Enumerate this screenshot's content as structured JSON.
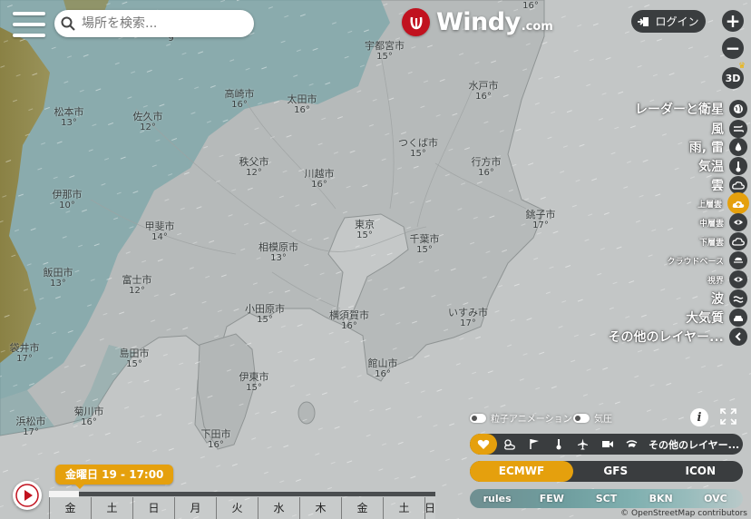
{
  "header": {
    "search_placeholder": "場所を検索...",
    "logo_word": "Windy",
    "logo_domain": ".com",
    "login_label": "ログイン",
    "zoom_in": "+",
    "zoom_out": "−",
    "view_3d": "3D"
  },
  "map": {
    "cities": [
      {
        "name": "松本市",
        "temp": "13°"
      },
      {
        "name": "佐久市",
        "temp": "12°"
      },
      {
        "name": "高崎市",
        "temp": "16°"
      },
      {
        "name": "太田市",
        "temp": "16°"
      },
      {
        "name": "宇都宮市",
        "temp": "15°"
      },
      {
        "name": "水戸市",
        "temp": "16°"
      },
      {
        "name": "つくば市",
        "temp": "15°"
      },
      {
        "name": "行方市",
        "temp": "16°"
      },
      {
        "name": "伊那市",
        "temp": "10°"
      },
      {
        "name": "秩父市",
        "temp": "12°"
      },
      {
        "name": "川越市",
        "temp": "16°"
      },
      {
        "name": "甲斐市",
        "temp": "14°"
      },
      {
        "name": "東京",
        "temp": "15°"
      },
      {
        "name": "千葉市",
        "temp": "15°"
      },
      {
        "name": "銚子市",
        "temp": "17°"
      },
      {
        "name": "相模原市",
        "temp": "13°"
      },
      {
        "name": "飯田市",
        "temp": "13°"
      },
      {
        "name": "富士市",
        "temp": "12°"
      },
      {
        "name": "小田原市",
        "temp": "15°"
      },
      {
        "name": "横須賀市",
        "temp": "16°"
      },
      {
        "name": "いすみ市",
        "temp": "17°"
      },
      {
        "name": "島田市",
        "temp": "15°"
      },
      {
        "name": "館山市",
        "temp": "16°"
      },
      {
        "name": "伊東市",
        "temp": "15°"
      },
      {
        "name": "浜松市",
        "temp": "17°"
      },
      {
        "name": "菊川市",
        "temp": "16°"
      },
      {
        "name": "下田市",
        "temp": "16°"
      },
      {
        "name": "袋井市",
        "temp": "17°"
      }
    ],
    "edge_temps": {
      "top_left": "9°",
      "top_right": "16°"
    }
  },
  "layers": [
    {
      "label": "レーダーと衛星",
      "icon": "globe-icon",
      "size": "big"
    },
    {
      "label": "風",
      "icon": "wind-icon",
      "size": "big"
    },
    {
      "label": "雨, 雷",
      "icon": "drop-icon",
      "size": "big"
    },
    {
      "label": "気温",
      "icon": "thermometer-icon",
      "size": "big"
    },
    {
      "label": "雲",
      "icon": "cloud-icon",
      "size": "big"
    },
    {
      "label": "上層雲",
      "icon": "cloud-up-icon",
      "size": "small",
      "active": true
    },
    {
      "label": "中層雲",
      "icon": "cloud-eye-icon",
      "size": "small"
    },
    {
      "label": "下層雲",
      "icon": "cloud-down-icon",
      "size": "small"
    },
    {
      "label": "クラウドベース",
      "icon": "cloud-base-icon",
      "size": "small"
    },
    {
      "label": "視界",
      "icon": "eye-icon",
      "size": "small"
    },
    {
      "label": "波",
      "icon": "waves-icon",
      "size": "big"
    },
    {
      "label": "大気質",
      "icon": "car-icon",
      "size": "big"
    },
    {
      "label": "その他のレイヤー...",
      "icon": "chevron-left-icon",
      "size": "big"
    }
  ],
  "controls": {
    "particles_label": "粒子アニメーション",
    "pressure_label": "気圧",
    "info": "i",
    "fav_more": "その他のレイヤー...",
    "models": [
      "ECMWF",
      "GFS",
      "ICON"
    ],
    "active_model": "ECMWF",
    "legend": [
      "rules",
      "FEW",
      "SCT",
      "BKN",
      "OVC"
    ],
    "attribution": "© OpenStreetMap contributors"
  },
  "timeline": {
    "current": "金曜日 19 - 17:00",
    "days": [
      "金",
      "土",
      "日",
      "月",
      "火",
      "水",
      "木",
      "金",
      "土",
      "日"
    ],
    "progress_fraction": 0.077
  },
  "colors": {
    "accent": "#e5a00d",
    "dark_button": "#3a3d3f",
    "logo_red": "#c1121f",
    "cloud_cover": "#6fa2a4"
  }
}
